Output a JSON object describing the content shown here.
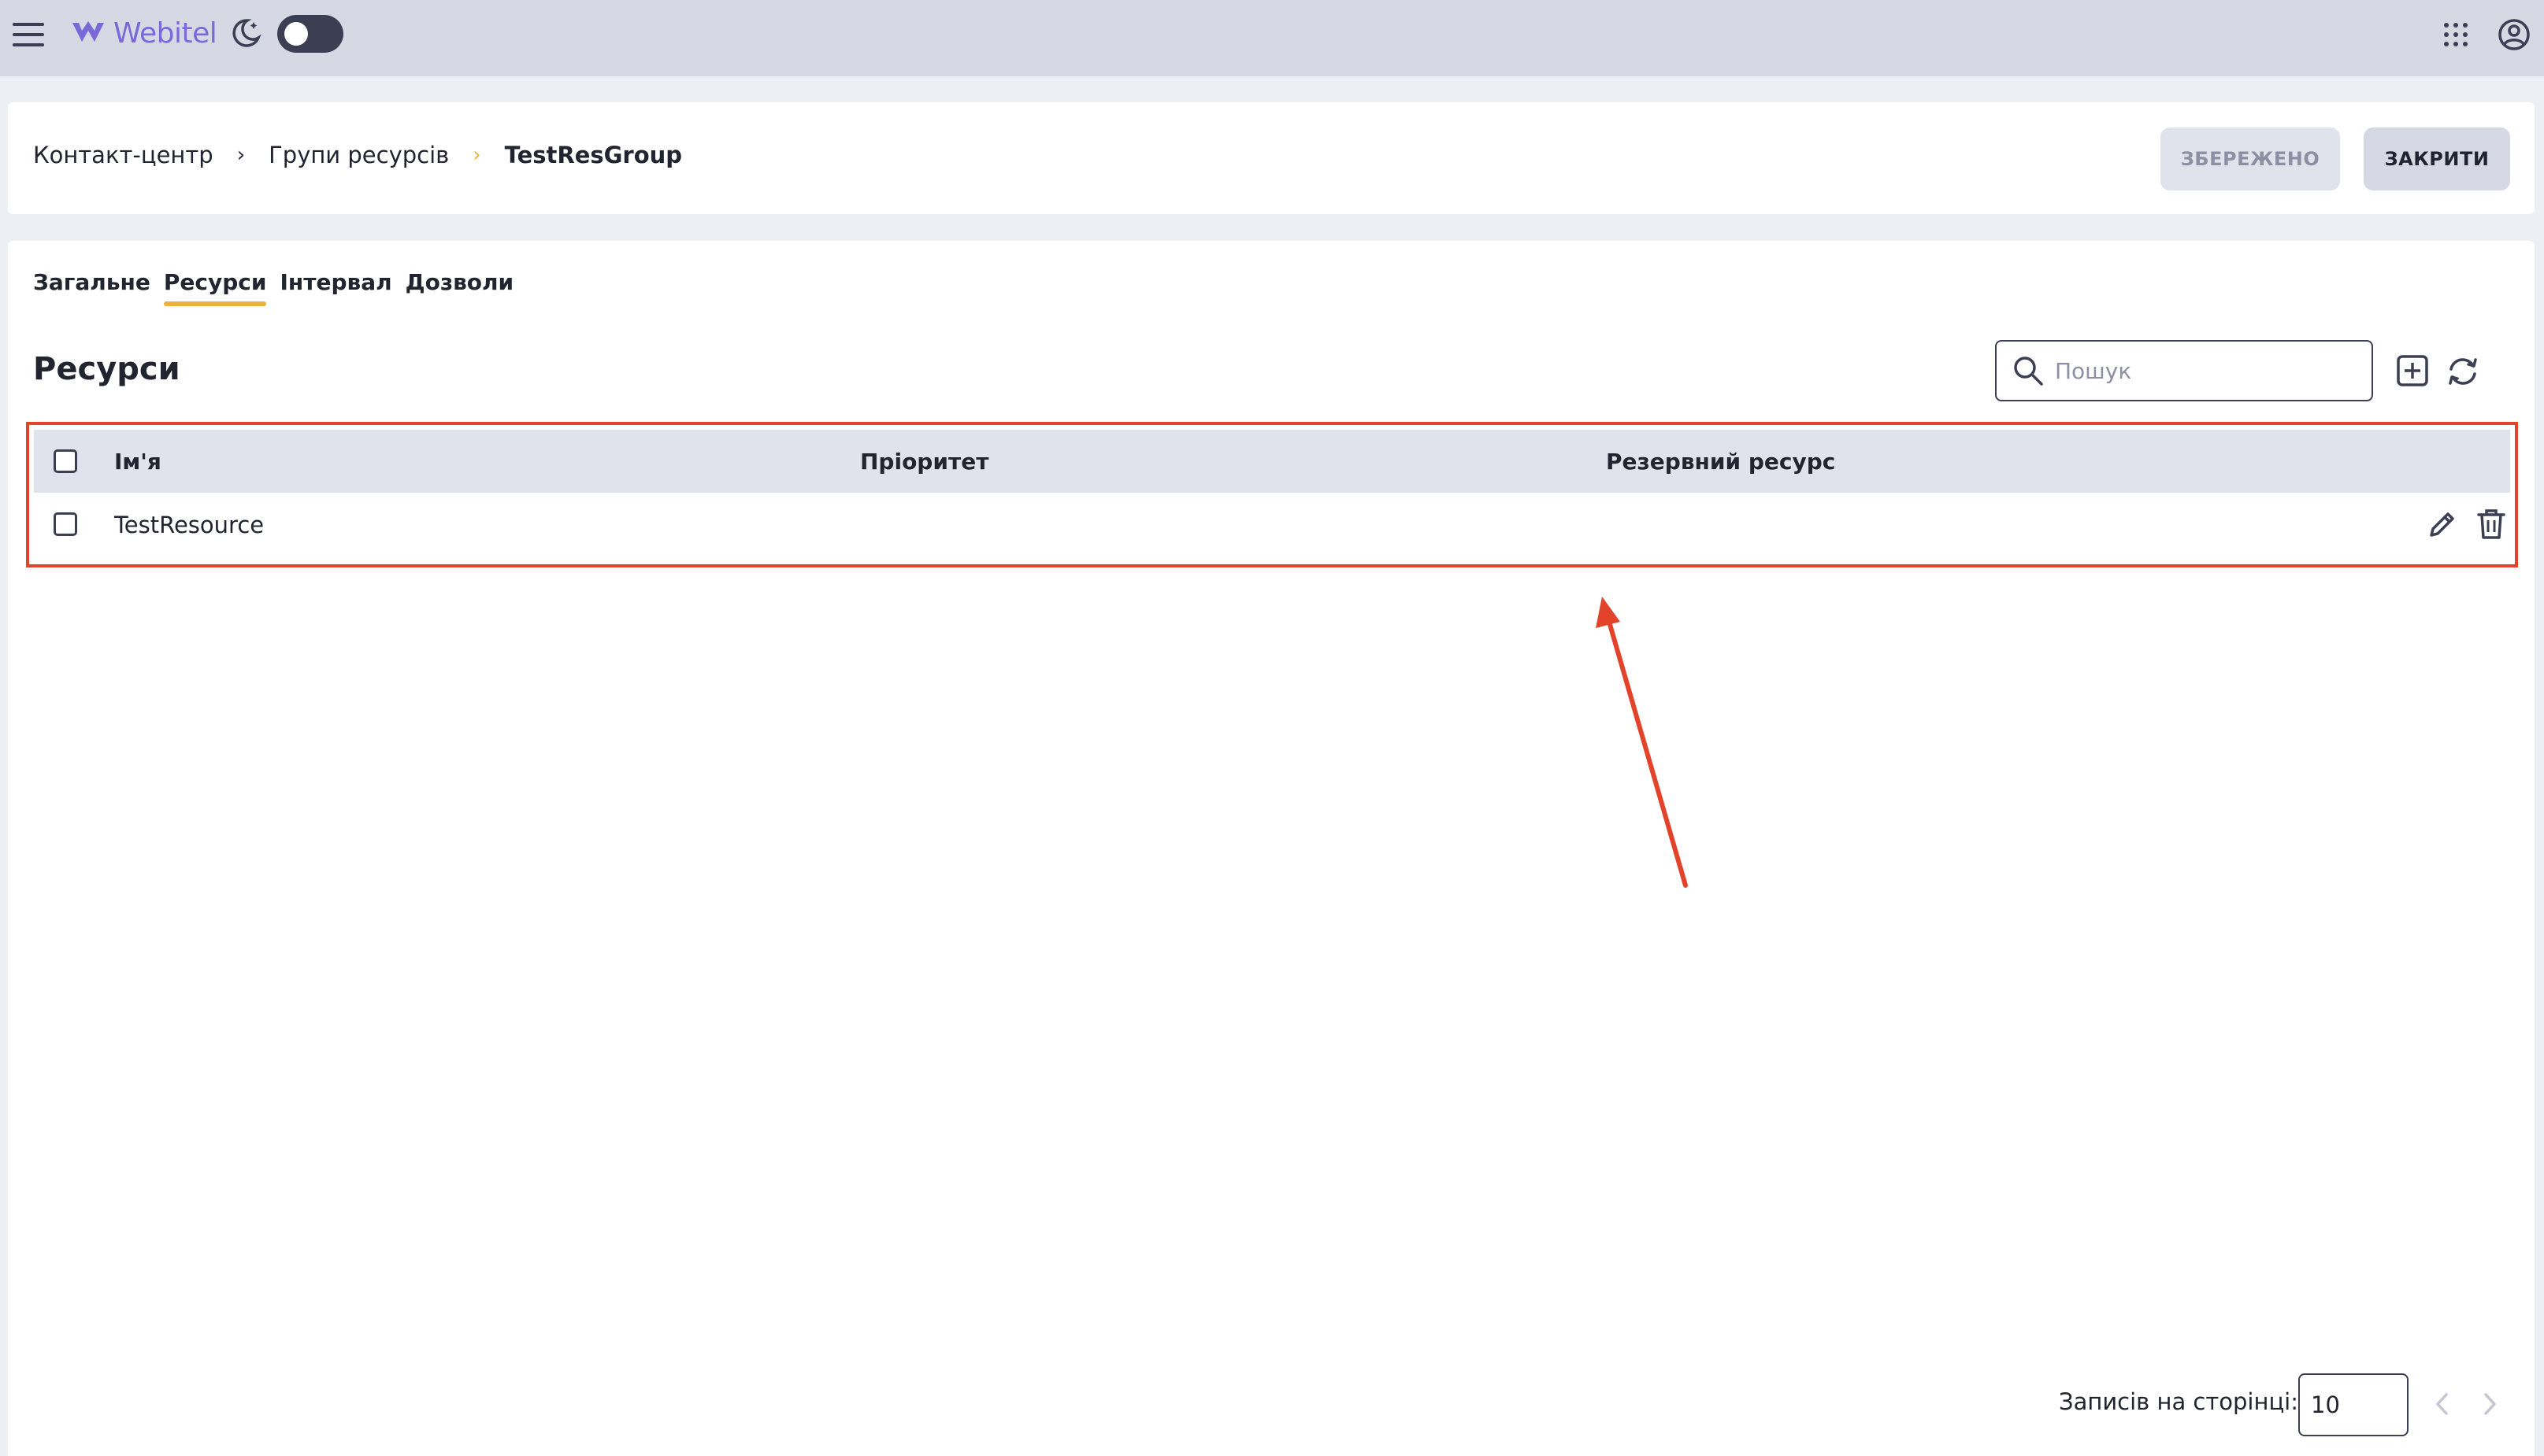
{
  "app": {
    "brand": "Webitel"
  },
  "header": {
    "breadcrumb": [
      "Контакт-центр",
      "Групи ресурсів",
      "TestResGroup"
    ],
    "saved_label": "ЗБЕРЕЖЕНО",
    "close_label": "ЗАКРИТИ"
  },
  "tabs": [
    {
      "label": "Загальне",
      "active": false
    },
    {
      "label": "Ресурси",
      "active": true
    },
    {
      "label": "Інтервал",
      "active": false
    },
    {
      "label": "Дозволи",
      "active": false
    }
  ],
  "section": {
    "title": "Ресурси",
    "search_placeholder": "Пошук"
  },
  "table": {
    "columns": [
      "Ім'я",
      "Пріоритет",
      "Резервний ресурс"
    ],
    "rows": [
      {
        "name": "TestResource",
        "priority": "",
        "reserve": ""
      }
    ]
  },
  "pagination": {
    "label": "Записів на сторінці:",
    "size": "10"
  },
  "annotation": {
    "highlight_color": "#E2432A"
  },
  "icons": [
    "menu-icon",
    "webitel-logo",
    "night-mode-icon",
    "apps-grid-icon",
    "account-icon",
    "search-icon",
    "add-icon",
    "refresh-icon",
    "edit-icon",
    "delete-icon",
    "chevron-left-icon",
    "chevron-right-icon"
  ]
}
